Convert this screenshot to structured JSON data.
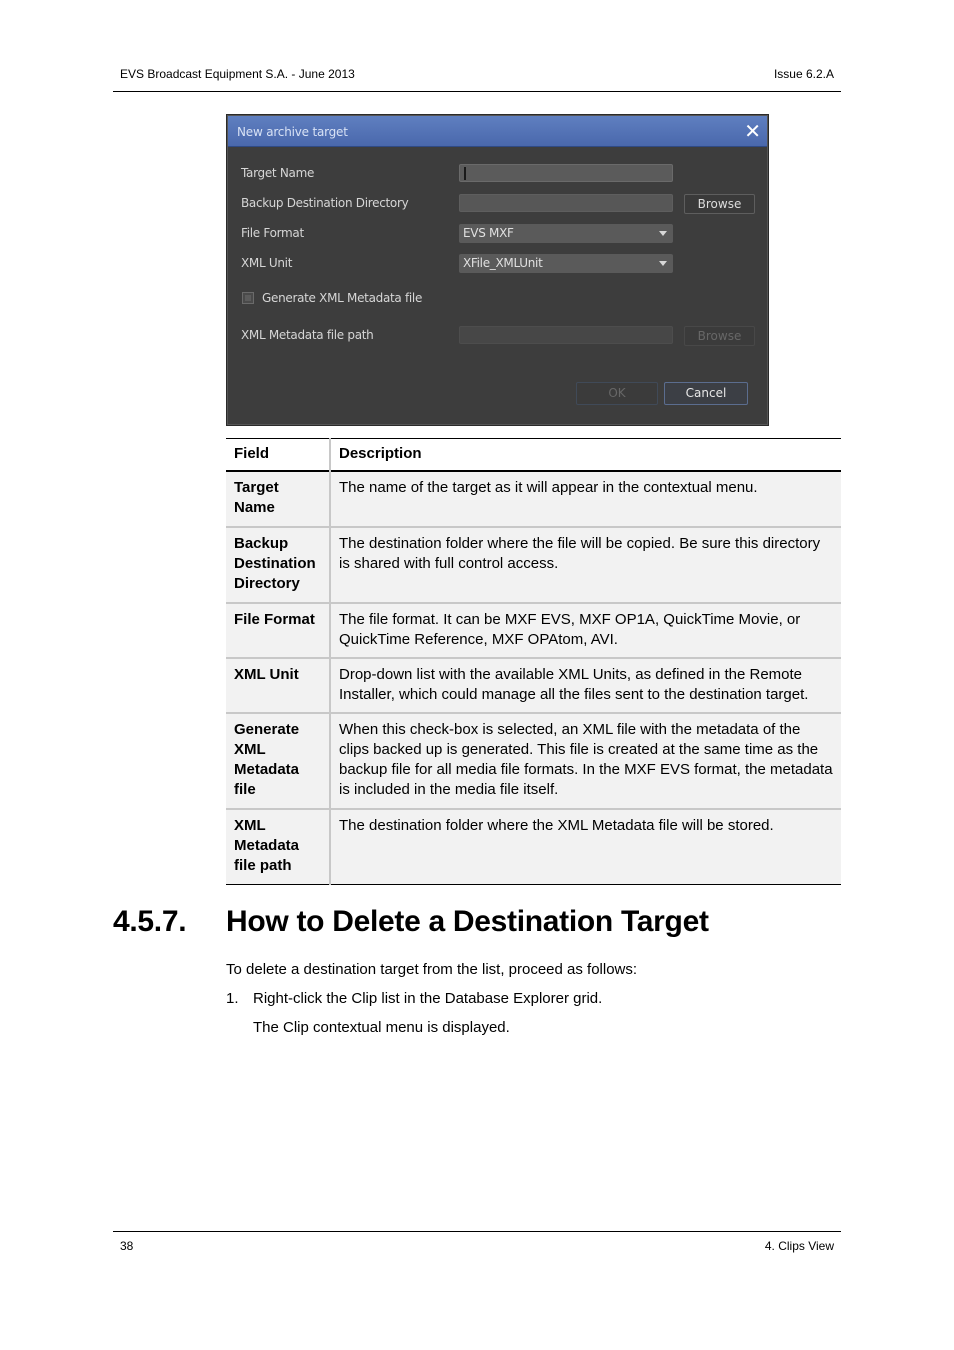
{
  "header": {
    "left": "EVS Broadcast Equipment S.A.  - June 2013",
    "right": "Issue 6.2.A"
  },
  "dialog": {
    "title": "New archive target",
    "close_icon": "close-icon",
    "fields": {
      "target_name_label": "Target Name",
      "target_name_value": "",
      "backup_dir_label": "Backup Destination Directory",
      "backup_dir_value": "",
      "browse_label": "Browse",
      "file_format_label": "File Format",
      "file_format_value": "EVS MXF",
      "xml_unit_label": "XML Unit",
      "xml_unit_value": "XFile_XMLUnit",
      "generate_xml_label": "Generate XML Metadata file",
      "generate_xml_checked": false,
      "xml_path_label": "XML Metadata file path",
      "xml_path_value": "",
      "xml_browse_label": "Browse"
    },
    "buttons": {
      "ok": "OK",
      "cancel": "Cancel"
    }
  },
  "table": {
    "headers": [
      "Field",
      "Description"
    ],
    "rows": [
      {
        "field": "Target Name",
        "description": "The name of the target as it will appear in the contextual menu."
      },
      {
        "field": "Backup Destination Directory",
        "description": "The destination folder where the file will be copied. Be sure this directory is shared with full control access."
      },
      {
        "field": "File Format",
        "description": "The file format. It can be MXF EVS, MXF OP1A, QuickTime Movie, or QuickTime Reference, MXF OPAtom, AVI."
      },
      {
        "field": "XML Unit",
        "description": "Drop-down list with the available XML Units, as defined in the Remote Installer, which could manage all the files sent to the destination target."
      },
      {
        "field": "Generate XML Metadata file",
        "description": "When this check-box is selected, an XML file with the metadata of the clips backed up is generated. This file is created at the same time as the backup file for all media file formats. In the MXF EVS format, the metadata is included in the media file itself."
      },
      {
        "field": "XML Metadata file path",
        "description": "The destination folder where the XML Metadata file will be stored."
      }
    ]
  },
  "section": {
    "number": "4.5.7.",
    "title": "How to Delete a Destination Target",
    "intro": "To delete a destination target from the list, proceed as follows:",
    "steps": [
      {
        "num": "1.",
        "text": "Right-click the Clip list in the Database Explorer grid.",
        "result": "The Clip contextual menu is displayed."
      }
    ]
  },
  "footer": {
    "page_number": "38",
    "chapter": "4. Clips View"
  }
}
